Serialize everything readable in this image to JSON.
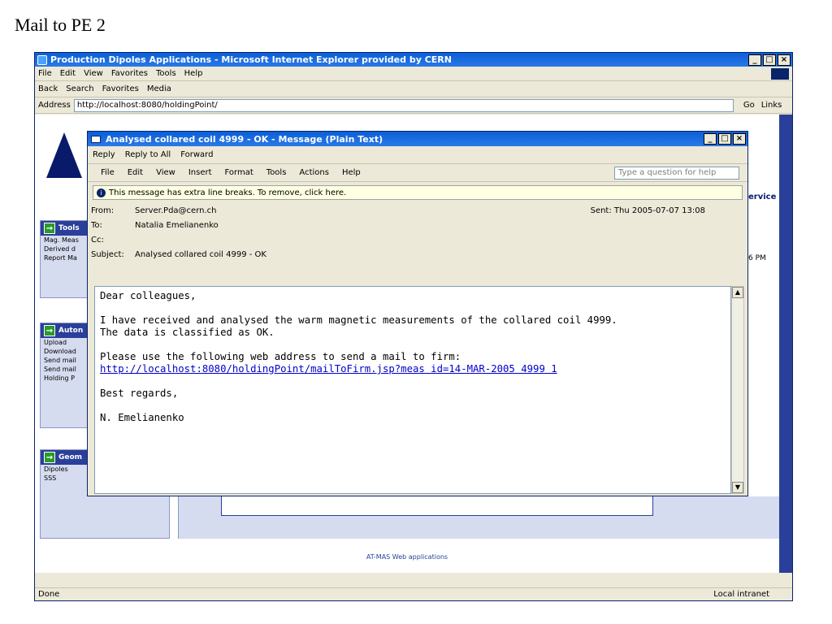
{
  "slide": {
    "title": "Mail to PE 2"
  },
  "ie": {
    "title": "Production Dipoles Applications - Microsoft Internet Explorer provided by CERN",
    "menu": [
      "File",
      "Edit",
      "View",
      "Favorites",
      "Tools",
      "Help"
    ],
    "toolbar": [
      "Back",
      "Search",
      "Favorites",
      "Media"
    ],
    "address_label": "Address",
    "address": "http://localhost:8080/holdingPoint/",
    "go": "Go",
    "links": "Links"
  },
  "page": {
    "service": "ervice",
    "time": "6 PM",
    "sidebar": [
      {
        "title": "Tools",
        "items": [
          "Mag. Meas",
          "Derived d",
          "Report Ma"
        ]
      },
      {
        "title": "Auton",
        "items": [
          "Upload",
          "Download",
          "Send mail",
          "Send mail",
          "Holding P"
        ]
      },
      {
        "title": "Geom",
        "items": [
          "Dipoles",
          "SSS"
        ]
      }
    ],
    "footer": "AT-MAS Web applications"
  },
  "status": {
    "left": "Done",
    "zone": "Local intranet"
  },
  "message": {
    "title": "Analysed collared coil 4999 - OK - Message (Plain Text)",
    "toolbar": [
      "Reply",
      "Reply to All",
      "Forward"
    ],
    "menu": [
      "File",
      "Edit",
      "View",
      "Insert",
      "Format",
      "Tools",
      "Actions",
      "Help"
    ],
    "help_placeholder": "Type a question for help",
    "info": "This message has extra line breaks. To remove, click here.",
    "from_label": "From:",
    "from": "Server.Pda@cern.ch",
    "sent_label": "Sent:",
    "sent": "Thu 2005-07-07 13:08",
    "to_label": "To:",
    "to": "Natalia Emelianenko",
    "cc_label": "Cc:",
    "cc": "",
    "subject_label": "Subject:",
    "subject": "Analysed collared coil 4999 - OK",
    "body_lines": [
      "Dear colleagues,",
      "",
      "I have received and analysed the warm magnetic measurements of the collared coil 4999.",
      "The data is classified as OK.",
      "",
      "Please use the following web address to send a mail to firm:"
    ],
    "link": "http://localhost:8080/holdingPoint/mailToFirm.jsp?meas id=14-MAR-2005 4999 1",
    "closing_lines": [
      "",
      "Best regards,",
      "",
      "N. Emelianenko"
    ]
  }
}
